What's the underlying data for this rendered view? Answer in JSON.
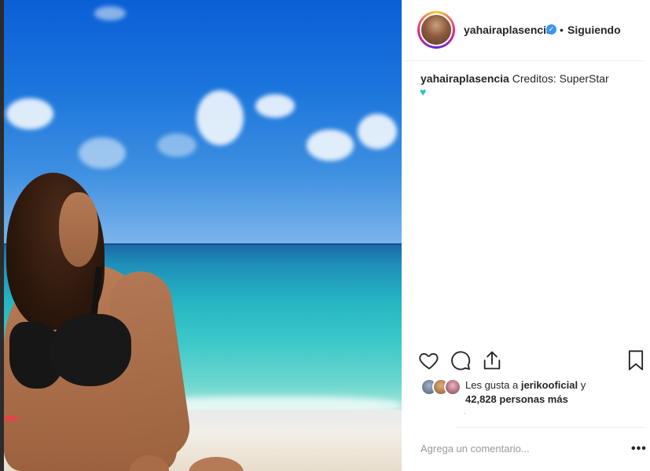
{
  "post": {
    "username": "yahairaplasencia",
    "verified_icon": "verified-badge-icon",
    "separator": "•",
    "follow_status": "Siguiendo",
    "caption_user": "yahairaplasencia",
    "caption_text": "Creditos: SuperStar",
    "caption_emoji": "♥",
    "likes_prefix": "Les gusta a",
    "likes_user": "jerikooficial",
    "likes_suffix": "y",
    "likes_count": "42,828",
    "likes_tail": "personas más",
    "timestamp": "·",
    "comment_placeholder": "Agrega un comentario...",
    "more_label": "•••"
  },
  "icons": {
    "like": "heart-icon",
    "comment": "comment-icon",
    "share": "share-icon",
    "save": "bookmark-icon"
  },
  "colors": {
    "accent": "#3897f0",
    "emoji_heart": "#27c4c4",
    "text": "#262626",
    "muted": "#999999"
  }
}
